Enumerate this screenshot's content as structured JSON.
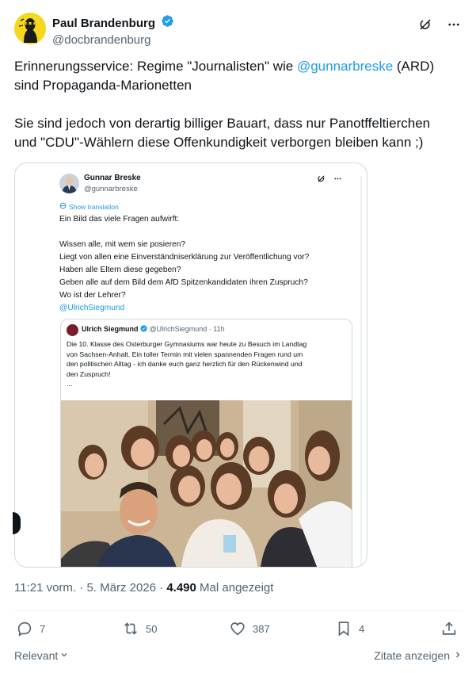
{
  "header": {
    "name": "Paul Brandenburg",
    "handle": "@docbrandenburg"
  },
  "tweet": {
    "line1_pre": "Erinnerungsservice: Regime \"Journalisten\" wie ",
    "line1_mention": "@gunnarbreske",
    "line1_post": " (ARD)",
    "line2": "sind Propaganda-Marionetten",
    "line3": "Sie sind jedoch von derartig billiger Bauart, dass nur Panotffeltierchen",
    "line4": "und \"CDU\"-Wählern diese Offenkundigkeit verborgen bleiben kann ;)"
  },
  "embedded": {
    "name": "Gunnar Breske",
    "handle": "@gunnarbreske",
    "translate": "Show translation",
    "lines": [
      "Ein Bild das viele Fragen aufwirft:",
      "Wissen alle, mit wem sie posieren?",
      "Liegt von allen eine Einverständniserklärung zur Veröffentlichung vor?",
      "Haben alle Eltern diese gegeben?",
      "Geben alle auf dem Bild dem AfD Spitzenkandidaten ihren Zuspruch?",
      "Wo ist der Lehrer?"
    ],
    "mention": "@UlrichSiegmund",
    "quoted": {
      "name": "Ulrich Siegmund",
      "handle": "@UlrichSiegmund",
      "time": "11h",
      "body": [
        "Die 10. Klasse des Osterburger Gymnasiums war heute zu Besuch im Landtag",
        "von Sachsen-Anhalt. Ein toller Termin mit vielen spannenden Fragen rund um",
        "den politischen Alltag - ich danke euch ganz herzlich für den Rückenwind und",
        "den Zuspruch!",
        "..."
      ]
    }
  },
  "meta": {
    "time": "11:21 vorm.",
    "date": "5. März 2026",
    "views": "4.490",
    "views_label": "Mal angezeigt"
  },
  "actions": {
    "replies": "7",
    "reposts": "50",
    "likes": "387",
    "bookmarks": "4"
  },
  "footer": {
    "sort": "Relevant",
    "quotes": "Zitate anzeigen"
  },
  "colors": {
    "accent": "#1d9bf0",
    "text": "#0f1419",
    "muted": "#536471",
    "avatar_bg": "#f5d81d"
  }
}
